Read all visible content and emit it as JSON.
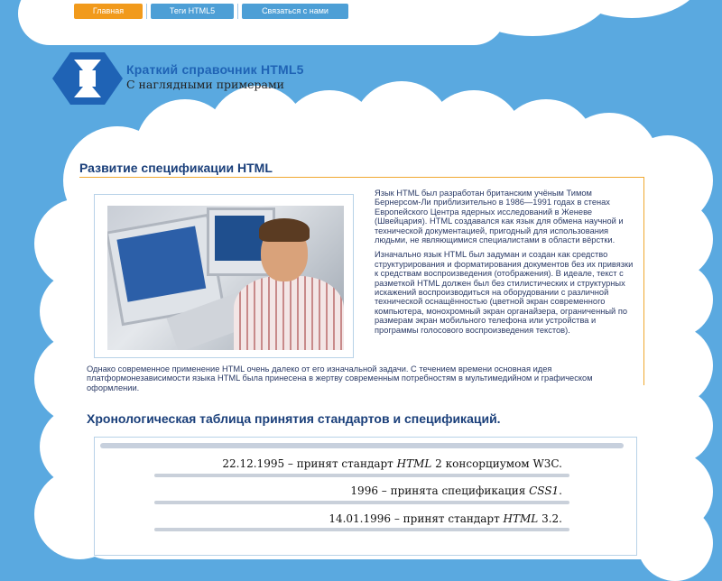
{
  "nav": {
    "home": "Главная",
    "tags": "Теги HTML5",
    "contact": "Связаться с нами"
  },
  "logo": {
    "title": "Краткий справочник HTML5",
    "subtitle": "С наглядными примерами"
  },
  "article": {
    "title": "Развитие спецификации HTML",
    "photo_alt": "photo-tim-berners-lee",
    "para1": "Язык HTML был разработан британским учёным Тимом Бернерсом-Ли приблизительно в 1986—1991 годах в стенах Европейского Центра ядерных исследований в Женеве (Швейцария). HTML создавался как язык для обмена научной и технической документацией, пригодный для использования людьми, не являющимися специалистами в области вёрстки.",
    "para2": "Изначально язык HTML был задуман и создан как средство структурирования и форматирования документов без их привязки к средствам воспроизведения (отображения). В идеале, текст с разметкой HTML должен был без стилистических и структурных искажений воспроизводиться на оборудовании с различной технической оснащённостью (цветной экран современного компьютера, монохромный экран органайзера, ограниченный по размерам экран мобильного телефона или устройства и программы голосового воспроизведения текстов).",
    "para3": "Однако современное применение HTML очень далеко от его изначальной задачи. С течением времени основная идея платформонезависимости языка HTML была принесена в жертву современным потребностям в мультимедийном и графическом оформлении."
  },
  "chronology": {
    "title": "Хронологическая таблица принятия стандартов и спецификаций.",
    "rows": [
      {
        "prefix": "22.12.1995 – принят стандарт ",
        "em": "HTML",
        "suffix": " 2 консорциумом W3C."
      },
      {
        "prefix": "1996 – принята спецификация ",
        "em": "CSS1",
        "suffix": "."
      },
      {
        "prefix": "14.01.1996 – принят стандарт ",
        "em": "HTML",
        "suffix": " 3.2."
      }
    ]
  },
  "colors": {
    "sky": "#5aa9e0",
    "nav_active": "#f19a1c",
    "nav_inactive": "#4d9fd6",
    "heading": "#1a3f7a",
    "logo_blue": "#1f63b5",
    "border_accent": "#f0a830"
  }
}
